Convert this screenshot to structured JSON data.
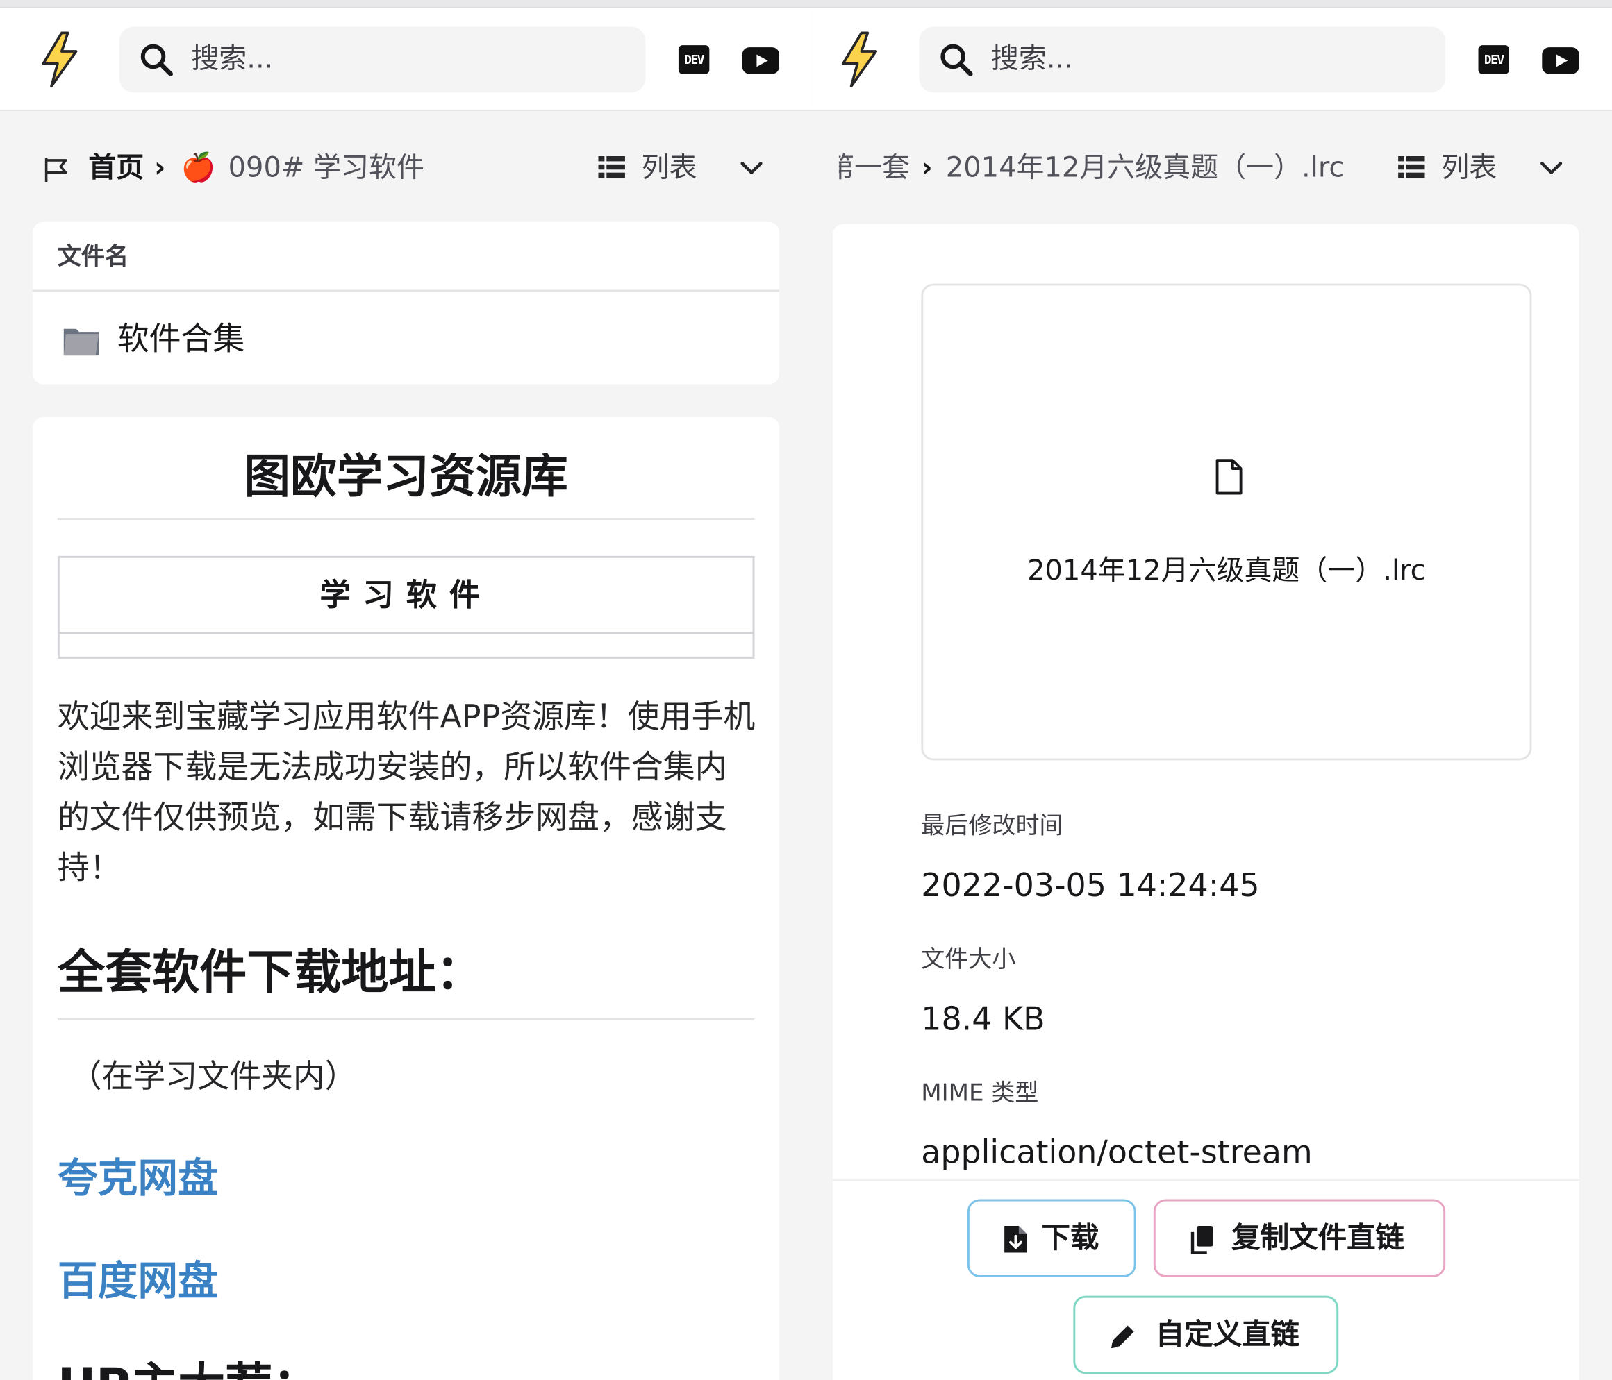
{
  "header": {
    "search_placeholder": "搜索...",
    "dev_badge": "DEV"
  },
  "left": {
    "breadcrumb": {
      "home": "首页",
      "separator": "›",
      "current_emoji": "🍎",
      "current": "090# 学习软件"
    },
    "view": {
      "label": "列表"
    },
    "file_list": {
      "column_header": "文件名",
      "items": [
        {
          "name": "软件合集"
        }
      ]
    },
    "readme": {
      "title": "图欧学习资源库",
      "table_header": "学习软件",
      "paragraph": "欢迎来到宝藏学习应用软件APP资源库！使用手机浏览器下载是无法成功安装的，所以软件合集内的文件仅供预览，如需下载请移步网盘，感谢支持！",
      "heading": "全套软件下载地址：",
      "note": "（在学习文件夹内）",
      "links": [
        "夸克网盘",
        "百度网盘"
      ],
      "next_heading_partial": "UP主大荐："
    }
  },
  "right": {
    "breadcrumb": {
      "prev_partial": "第一套",
      "separator": "›",
      "current": "2014年12月六级真题（一）.lrc"
    },
    "view": {
      "label": "列表"
    },
    "preview": {
      "file_name": "2014年12月六级真题（一）.lrc"
    },
    "meta": {
      "modified_label": "最后修改时间",
      "modified_value": "2022-03-05 14:24:45",
      "size_label": "文件大小",
      "size_value": "18.4 KB",
      "mime_label": "MIME 类型",
      "mime_value": "application/octet-stream"
    },
    "actions": {
      "download": "下载",
      "copy_link": "复制文件直链",
      "custom_link": "自定义直链"
    }
  },
  "colors": {
    "link": "#3b82c4",
    "download_border": "#7cc3ea",
    "copy_border": "#e9a4c4",
    "custom_border": "#7fd8c4",
    "logo_yellow": "#fcd34d"
  }
}
